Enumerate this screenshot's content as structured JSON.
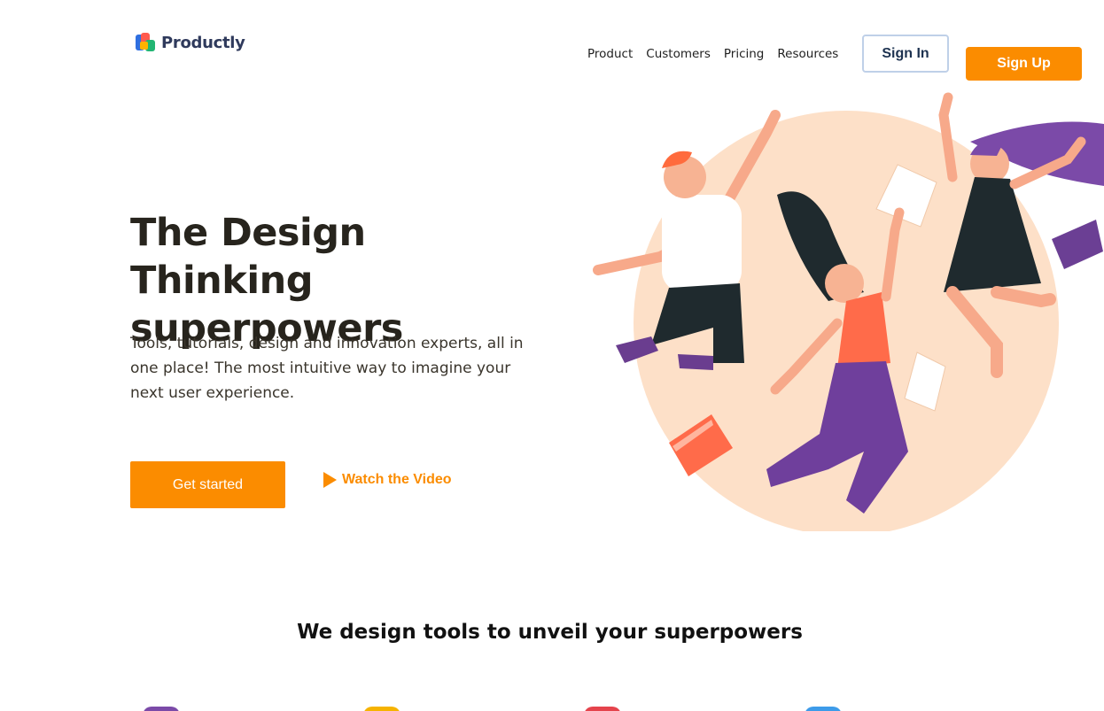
{
  "brand": {
    "name": "Productly"
  },
  "nav": {
    "items": [
      "Product",
      "Customers",
      "Pricing",
      "Resources"
    ],
    "sign_in": "Sign In",
    "sign_up": "Sign Up"
  },
  "hero": {
    "title": "The Design Thinking superpowers",
    "subtitle": "Tools, tutorials, design and innovation experts, all in one place! The most intuitive way to imagine your next user experience.",
    "cta_primary": "Get started",
    "cta_secondary": "Watch the Video"
  },
  "section": {
    "title": "We design tools to unveil your superpowers",
    "feature_icons": [
      {
        "icon": "feature-icon-purple",
        "color": "#7b4aa8"
      },
      {
        "icon": "feature-icon-yellow",
        "color": "#f6b300"
      },
      {
        "icon": "feature-icon-red",
        "color": "#e5434c"
      },
      {
        "icon": "feature-icon-blue",
        "color": "#3d9be9"
      }
    ]
  },
  "colors": {
    "accent": "#fb8c00",
    "heading": "#27241d",
    "illustration_bg": "#fde0c8"
  }
}
